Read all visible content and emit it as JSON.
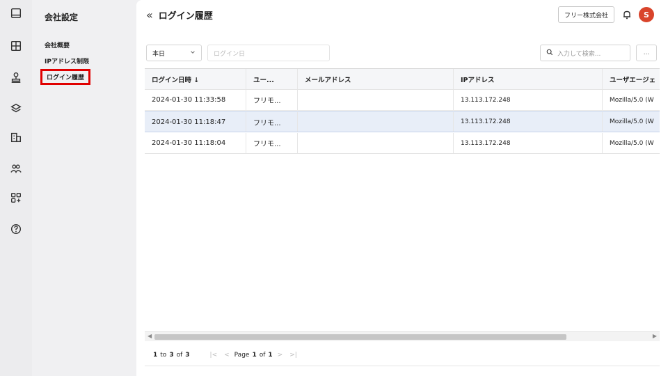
{
  "rail": {
    "icons": [
      "inbox-icon",
      "table-layout-icon",
      "stamp-icon",
      "layers-icon",
      "building-icon",
      "users-icon",
      "apps-add-icon",
      "help-icon"
    ]
  },
  "subnav": {
    "title": "会社設定",
    "items": [
      {
        "label": "会社概要",
        "active": false
      },
      {
        "label": "IPアドレス制限",
        "active": false
      },
      {
        "label": "ログイン履歴",
        "active": true
      }
    ]
  },
  "header": {
    "back_icon": "«",
    "title": "ログイン履歴",
    "company_button": "フリー株式会社",
    "avatar_initial": "S"
  },
  "filters": {
    "period_value": "本日",
    "date_placeholder": "ログイン日",
    "search_placeholder": "入力して検索...",
    "more_label": "..."
  },
  "table": {
    "columns": [
      "ログイン日時 ↓",
      "ユー...",
      "メールアドレス",
      "IPアドレス",
      "ユーザエージェ"
    ],
    "rows": [
      {
        "datetime": "2024-01-30 11:33:58",
        "user": "フリモ...",
        "email": "",
        "ip": "13.113.172.248",
        "agent": "Mozilla/5.0 (W"
      },
      {
        "datetime": "2024-01-30 11:18:47",
        "user": "フリモ...",
        "email": "",
        "ip": "13.113.172.248",
        "agent": "Mozilla/5.0 (W"
      },
      {
        "datetime": "2024-01-30 11:18:04",
        "user": "フリモ...",
        "email": "",
        "ip": "13.113.172.248",
        "agent": "Mozilla/5.0 (W"
      }
    ],
    "selected_row": 1
  },
  "pagination": {
    "from": "1",
    "to_label": "to",
    "to": "3",
    "of_label": "of",
    "total": "3",
    "page_label": "Page",
    "page": "1",
    "page_of_label": "of",
    "page_total": "1"
  },
  "colors": {
    "accent_active_border": "#e00000",
    "avatar_bg": "#d9442b",
    "selected_row_bg": "#e8eef8"
  }
}
